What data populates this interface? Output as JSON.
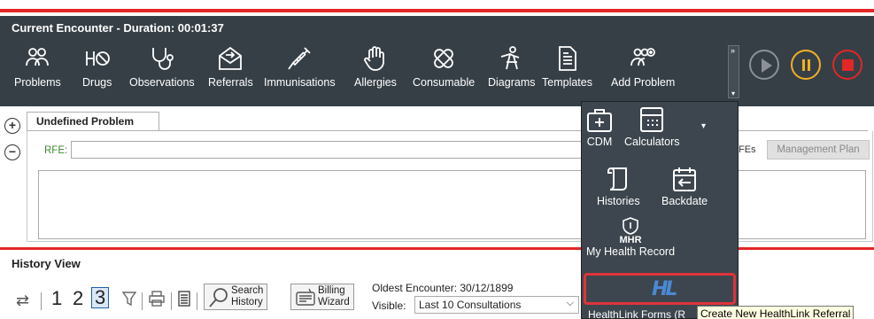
{
  "encounter": {
    "title": "Current Encounter - Duration: 00:01:37"
  },
  "toolbar": {
    "items": [
      {
        "label": "Problems",
        "icon": "problems-icon"
      },
      {
        "label": "Drugs",
        "icon": "drugs-icon"
      },
      {
        "label": "Observations",
        "icon": "stethoscope-icon"
      },
      {
        "label": "Referrals",
        "icon": "referral-envelope-icon"
      },
      {
        "label": "Immunisations",
        "icon": "syringe-icon"
      },
      {
        "label": "Allergies",
        "icon": "hand-icon"
      },
      {
        "label": "Consumable",
        "icon": "bandage-icon"
      },
      {
        "label": "Diagrams",
        "icon": "diagram-figure-icon"
      },
      {
        "label": "Templates",
        "icon": "template-document-icon"
      },
      {
        "label": "Add Problem",
        "icon": "add-problem-icon"
      }
    ],
    "overflow_symbol": "»",
    "media": {
      "play": "play-icon",
      "pause": "pause-icon",
      "stop": "stop-icon"
    }
  },
  "problem": {
    "tab": "Undefined Problem",
    "rfe_label": "RFE:",
    "rfe_value": "",
    "fes_label": "FEs",
    "management_plan": "Management Plan"
  },
  "history": {
    "title": "History View",
    "pages": [
      "1",
      "2",
      "3"
    ],
    "selected_page": "3",
    "search_line1": "Search",
    "search_line2": "History",
    "billing_line1": "Billing",
    "billing_line2": "Wizard",
    "oldest": "Oldest Encounter: 30/12/1899",
    "visible_label": "Visible:",
    "visible_value": "Last 10 Consultations"
  },
  "panel": {
    "items": [
      {
        "label": "CDM",
        "icon": "first-aid-kit-icon"
      },
      {
        "label": "Calculators",
        "icon": "calculator-icon"
      },
      {
        "label": "Histories",
        "icon": "scroll-icon"
      },
      {
        "label": "Backdate",
        "icon": "calendar-back-icon"
      },
      {
        "label": "My Health Record",
        "icon": "mhr-shield-icon",
        "badge": "MHR"
      }
    ],
    "healthlink_logo": "HL",
    "healthlink_label": "HealthLink Forms (R",
    "tooltip": "Create New HealthLink Referral"
  },
  "colors": {
    "toolbar_bg": "#363f46",
    "accent_red": "#e32626",
    "pause": "#f2b023",
    "rfe_green": "#3c8a2e",
    "hl_blue": "#4a8ad4"
  }
}
